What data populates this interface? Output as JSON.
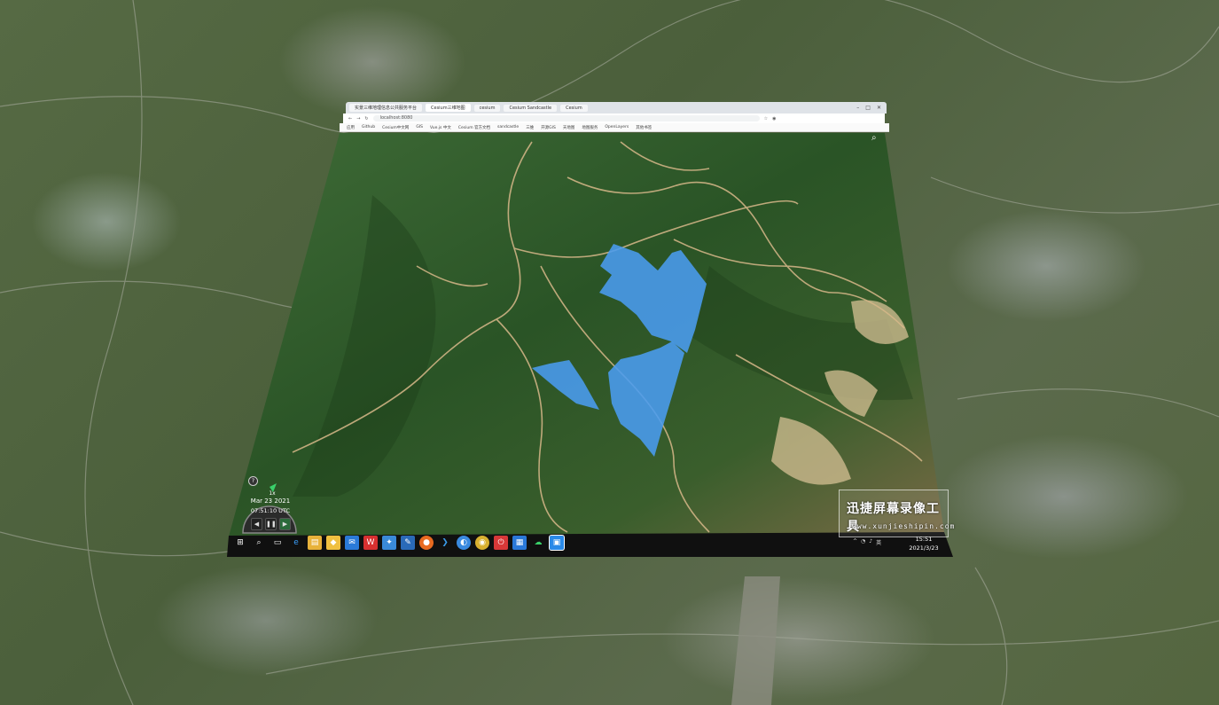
{
  "browser": {
    "tabs": [
      {
        "label": "实景三维地理信息公共服务平台"
      },
      {
        "label": "Cesium三维地图"
      },
      {
        "label": "cesium"
      },
      {
        "label": "Cesium Sandcastle"
      },
      {
        "label": "Cesium"
      }
    ],
    "url": "localhost:8080",
    "bookmarks": [
      "应用",
      "Github",
      "Cesium中文网",
      "GIS",
      "Vue.js 中文",
      "Cesium 官方文档",
      "sandcastle",
      "三维",
      "开源GIS",
      "天地图",
      "地图服务",
      "OpenLayers",
      "其他书签"
    ]
  },
  "clock": {
    "speed": "1x",
    "date": "Mar 23 2021",
    "time": "07:51:10 UTC"
  },
  "taskbar": {
    "time": "15:51",
    "date": "2021/3/23"
  },
  "watermark": {
    "title": "迅捷屏幕录像工具",
    "url": "www.xunjieshipin.com"
  },
  "colors": {
    "polygon": "#4a9cf0",
    "taskbar": "#101010",
    "terrain": "#2f5a25",
    "road": "#d8b88a"
  },
  "icons": [
    "search-icon",
    "help-icon",
    "windows-start-icon",
    "search-taskbar-icon",
    "task-view-icon",
    "edge-icon",
    "folder-icon",
    "store-icon",
    "mail-icon",
    "wps-icon",
    "vscode-icon",
    "firefox-icon",
    "chrome-icon",
    "wechat-icon"
  ]
}
